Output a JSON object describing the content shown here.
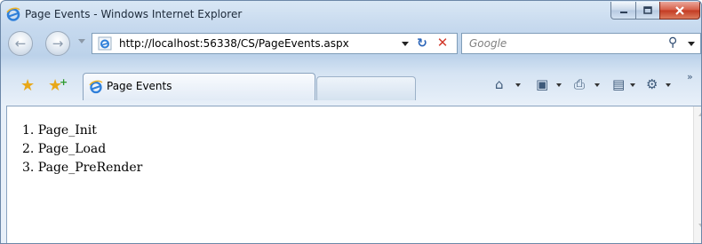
{
  "window": {
    "title": "Page Events - Windows Internet Explorer"
  },
  "nav": {
    "url": "http://localhost:56338/CS/PageEvents.aspx",
    "search_placeholder": "Google"
  },
  "tab": {
    "label": "Page Events"
  },
  "content": {
    "items": [
      "1. Page_Init",
      "2. Page_Load",
      "3. Page_PreRender"
    ]
  },
  "icons": {
    "favorites": "star-icon",
    "add_favorite": "add-favorite-icon",
    "home": "home-icon",
    "feeds": "rss-icon",
    "print": "printer-icon",
    "page": "page-icon",
    "tools": "gear-icon"
  },
  "colors": {
    "accent": "#2a64b8",
    "close": "#c23a22"
  }
}
